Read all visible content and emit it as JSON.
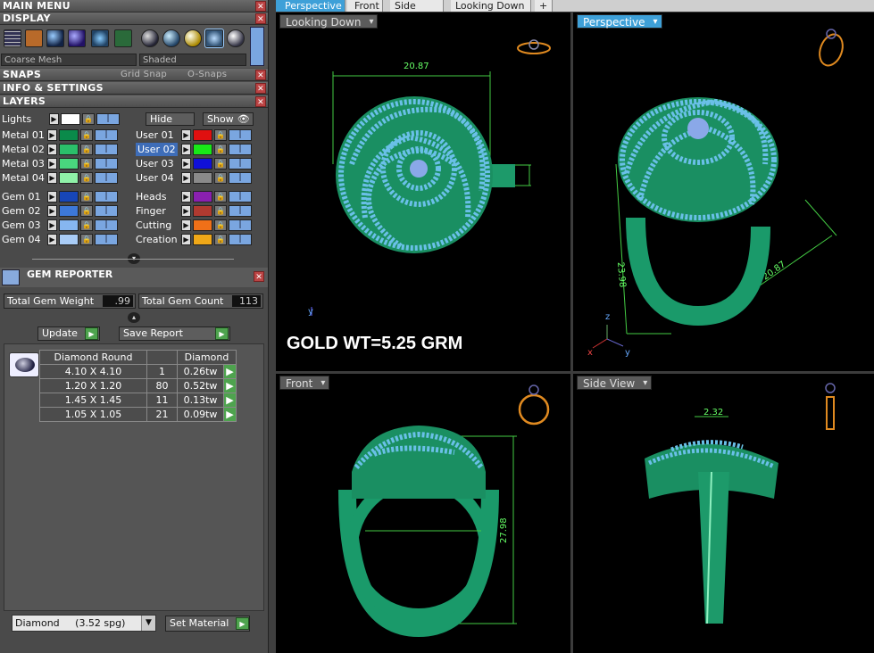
{
  "main_menu": "MAIN MENU",
  "display": {
    "title": "DISPLAY",
    "mesh": "Coarse Mesh",
    "shading": "Shaded"
  },
  "snaps": {
    "title": "SNAPS",
    "grid": "Grid Snap",
    "osnap": "O-Snaps"
  },
  "info": "INFO & SETTINGS",
  "layers": {
    "title": "LAYERS",
    "lights": "Lights",
    "hide": "Hide",
    "show": "Show",
    "left": [
      {
        "label": "Metal 01",
        "color": "#0a8a4a"
      },
      {
        "label": "Metal 02",
        "color": "#2bbf6a"
      },
      {
        "label": "Metal 03",
        "color": "#49d77e"
      },
      {
        "label": "Metal 04",
        "color": "#8ff0a8"
      },
      {
        "label": "Gem 01",
        "color": "#1746b8"
      },
      {
        "label": "Gem 02",
        "color": "#3d78d8"
      },
      {
        "label": "Gem 03",
        "color": "#86b6f0"
      },
      {
        "label": "Gem 04",
        "color": "#a9ccf6"
      }
    ],
    "right": [
      {
        "label": "User 01",
        "color": "#e01010"
      },
      {
        "label": "User 02",
        "color": "#18e818"
      },
      {
        "label": "User 03",
        "color": "#1010d8"
      },
      {
        "label": "User 04",
        "color": "#8a8a8a"
      },
      {
        "label": "Heads",
        "color": "#8a20b0"
      },
      {
        "label": "Finger",
        "color": "#b03a30"
      },
      {
        "label": "Cutting",
        "color": "#f07018"
      },
      {
        "label": "Creation",
        "color": "#f0a818"
      }
    ]
  },
  "gem_reporter": {
    "title": "GEM REPORTER",
    "weight_label": "Total Gem Weight",
    "weight": ".99",
    "count_label": "Total Gem Count",
    "count": "113",
    "update": "Update",
    "save": "Save Report",
    "headers": [
      "Diamond Round",
      "",
      "Diamond"
    ],
    "rows": [
      [
        "4.10 X 4.10",
        "1",
        "0.26tw"
      ],
      [
        "1.20 X 1.20",
        "80",
        "0.52tw"
      ],
      [
        "1.45 X 1.45",
        "11",
        "0.13tw"
      ],
      [
        "1.05 X 1.05",
        "21",
        "0.09tw"
      ]
    ],
    "material": "Diamond     (3.52 spg)",
    "set_material": "Set Material"
  },
  "tabs": [
    "Perspective",
    "Front",
    "Side View",
    "Looking Down",
    "+"
  ],
  "viewports": {
    "tl": "Looking Down",
    "tr": "Perspective",
    "bl": "Front",
    "br": "Side View"
  },
  "dims": {
    "top": "20.87",
    "persp_h": "23.98",
    "persp_w": "20.87",
    "front_h": "27.98",
    "side_w": "2.32"
  },
  "gold_wt": "GOLD WT=5.25 GRM",
  "axes": {
    "x": "x",
    "y": "y",
    "z": "z"
  }
}
